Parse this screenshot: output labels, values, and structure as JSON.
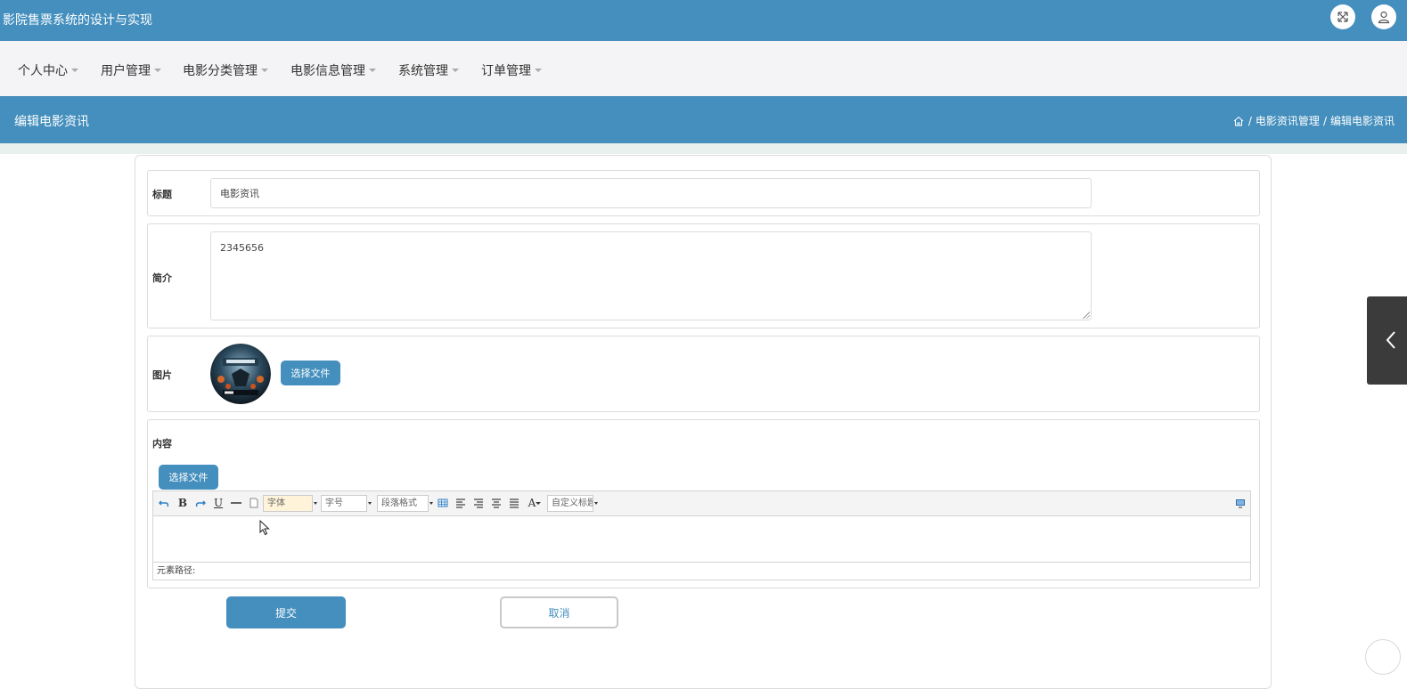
{
  "app": {
    "title": "影院售票系统的设计与实现"
  },
  "header": {
    "fullscreen_icon": "expand-icon",
    "user_icon": "user-icon"
  },
  "nav": {
    "items": [
      {
        "label": "个人中心"
      },
      {
        "label": "用户管理"
      },
      {
        "label": "电影分类管理"
      },
      {
        "label": "电影信息管理"
      },
      {
        "label": "系统管理"
      },
      {
        "label": "订单管理"
      }
    ]
  },
  "page": {
    "title": "编辑电影资讯",
    "breadcrumb": {
      "home_icon": "home-icon",
      "sep": "/",
      "parent": "电影资讯管理",
      "current": "编辑电影资讯"
    }
  },
  "form": {
    "title": {
      "label": "标题",
      "value": "电影资讯"
    },
    "summary": {
      "label": "简介",
      "value": "2345656"
    },
    "image": {
      "label": "图片",
      "button": "选择文件"
    },
    "content": {
      "label": "内容",
      "button": "选择文件",
      "toolbar": {
        "font_family": "字体",
        "font_size": "字号",
        "paragraph": "段落格式",
        "custom_title": "自定义标题",
        "bold": "B",
        "underline": "U",
        "font_color": "A"
      },
      "status_label": "元素路径:"
    },
    "submit": "提交",
    "cancel": "取消"
  }
}
